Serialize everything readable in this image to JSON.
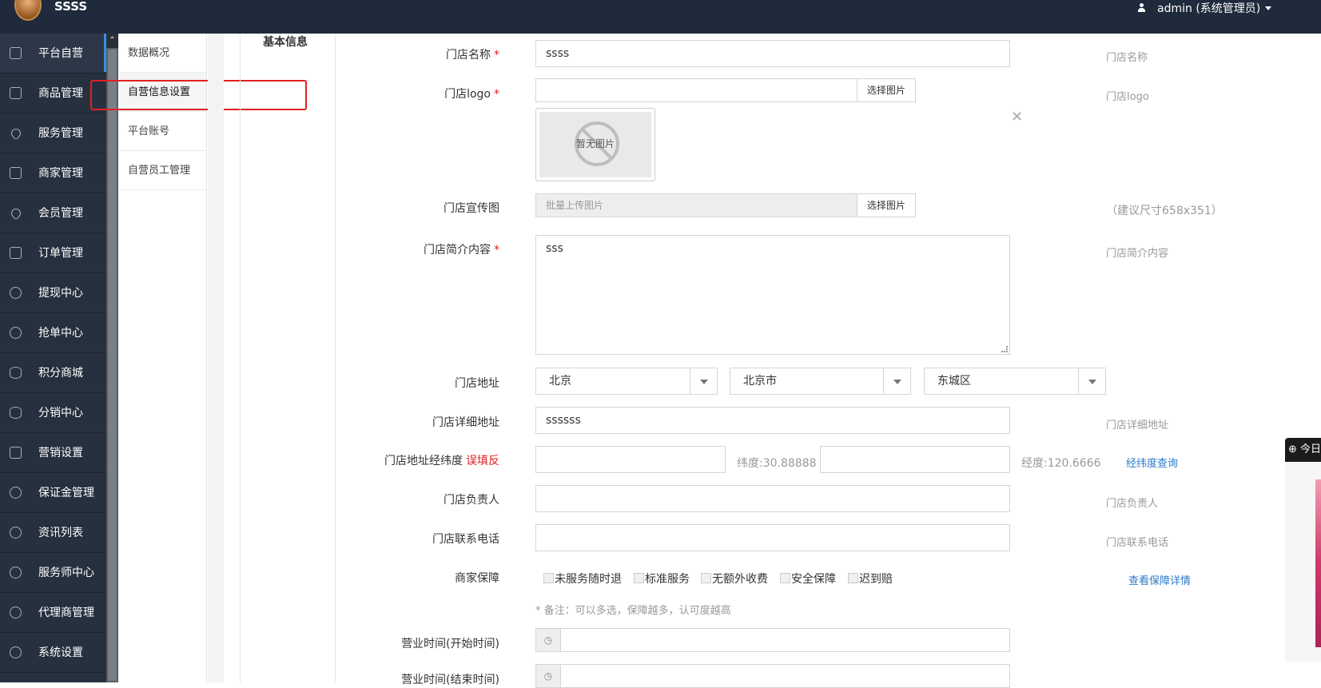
{
  "header": {
    "brand": "SSSS",
    "user": "admin (系统管理员)"
  },
  "sidebar": {
    "items": [
      {
        "label": "平台自营",
        "icon": "monitor-icon",
        "active": true
      },
      {
        "label": "商品管理",
        "icon": "cube-icon"
      },
      {
        "label": "服务管理",
        "icon": "heart-icon"
      },
      {
        "label": "商家管理",
        "icon": "store-icon"
      },
      {
        "label": "会员管理",
        "icon": "diamond-icon"
      },
      {
        "label": "订单管理",
        "icon": "list-icon"
      },
      {
        "label": "提现中心",
        "icon": "money-bag-icon"
      },
      {
        "label": "抢单中心",
        "icon": "money-bag-icon"
      },
      {
        "label": "积分商城",
        "icon": "database-icon"
      },
      {
        "label": "分销中心",
        "icon": "database-icon"
      },
      {
        "label": "营销设置",
        "icon": "gift-icon"
      },
      {
        "label": "保证金管理",
        "icon": "shield-icon"
      },
      {
        "label": "资讯列表",
        "icon": "shield-icon"
      },
      {
        "label": "服务师中心",
        "icon": "shield-icon"
      },
      {
        "label": "代理商管理",
        "icon": "shield-icon"
      },
      {
        "label": "系统设置",
        "icon": "gear-icon"
      }
    ]
  },
  "submenu": {
    "items": [
      "数据概况",
      "自营信息设置",
      "平台账号",
      "自营员工管理"
    ],
    "active": "自营信息设置"
  },
  "section": {
    "title": "基本信息"
  },
  "form": {
    "store_name": {
      "label": "门店名称",
      "value": "ssss",
      "hint": "门店名称",
      "required": "*"
    },
    "logo": {
      "label": "门店logo",
      "pick": "选择图片",
      "no_image": "暂无图片",
      "hint": "门店logo",
      "required": "*"
    },
    "banner": {
      "label": "门店宣传图",
      "placeholder": "批量上传图片",
      "pick": "选择图片",
      "hint": "（建议尺寸658x351）"
    },
    "intro": {
      "label": "门店简介内容",
      "value": "sss",
      "hint": "门店简介内容",
      "required": "*"
    },
    "address": {
      "label": "门店地址",
      "province": "北京",
      "city": "北京市",
      "district": "东城区"
    },
    "detail_address": {
      "label": "门店详细地址",
      "value": "ssssss",
      "hint": "门店详细地址"
    },
    "coords": {
      "label": "门店地址经纬度",
      "warn": "误填反",
      "lat_text": "纬度:30.88888",
      "lng_text": "经度:120.6666",
      "lookup": "经纬度查询"
    },
    "manager": {
      "label": "门店负责人",
      "hint": "门店负责人"
    },
    "phone": {
      "label": "门店联系电话",
      "hint": "门店联系电话"
    },
    "guarantee": {
      "label": "商家保障",
      "options": [
        "未服务随时退",
        "标准服务",
        "无额外收费",
        "安全保障",
        "迟到赔"
      ],
      "details_link": "查看保障详情",
      "note": "* 备注：可以多选，保障越多，认可度越高"
    },
    "open_time": {
      "label": "营业时间(开始时间)"
    },
    "close_time": {
      "label": "营业时间(结束时间)"
    }
  },
  "widget": {
    "title": "今日"
  },
  "colors": {
    "topbar": "#1f2a3c",
    "sidebar": "#26303f",
    "highlight": "#e02020",
    "link": "#2a7ac9"
  }
}
